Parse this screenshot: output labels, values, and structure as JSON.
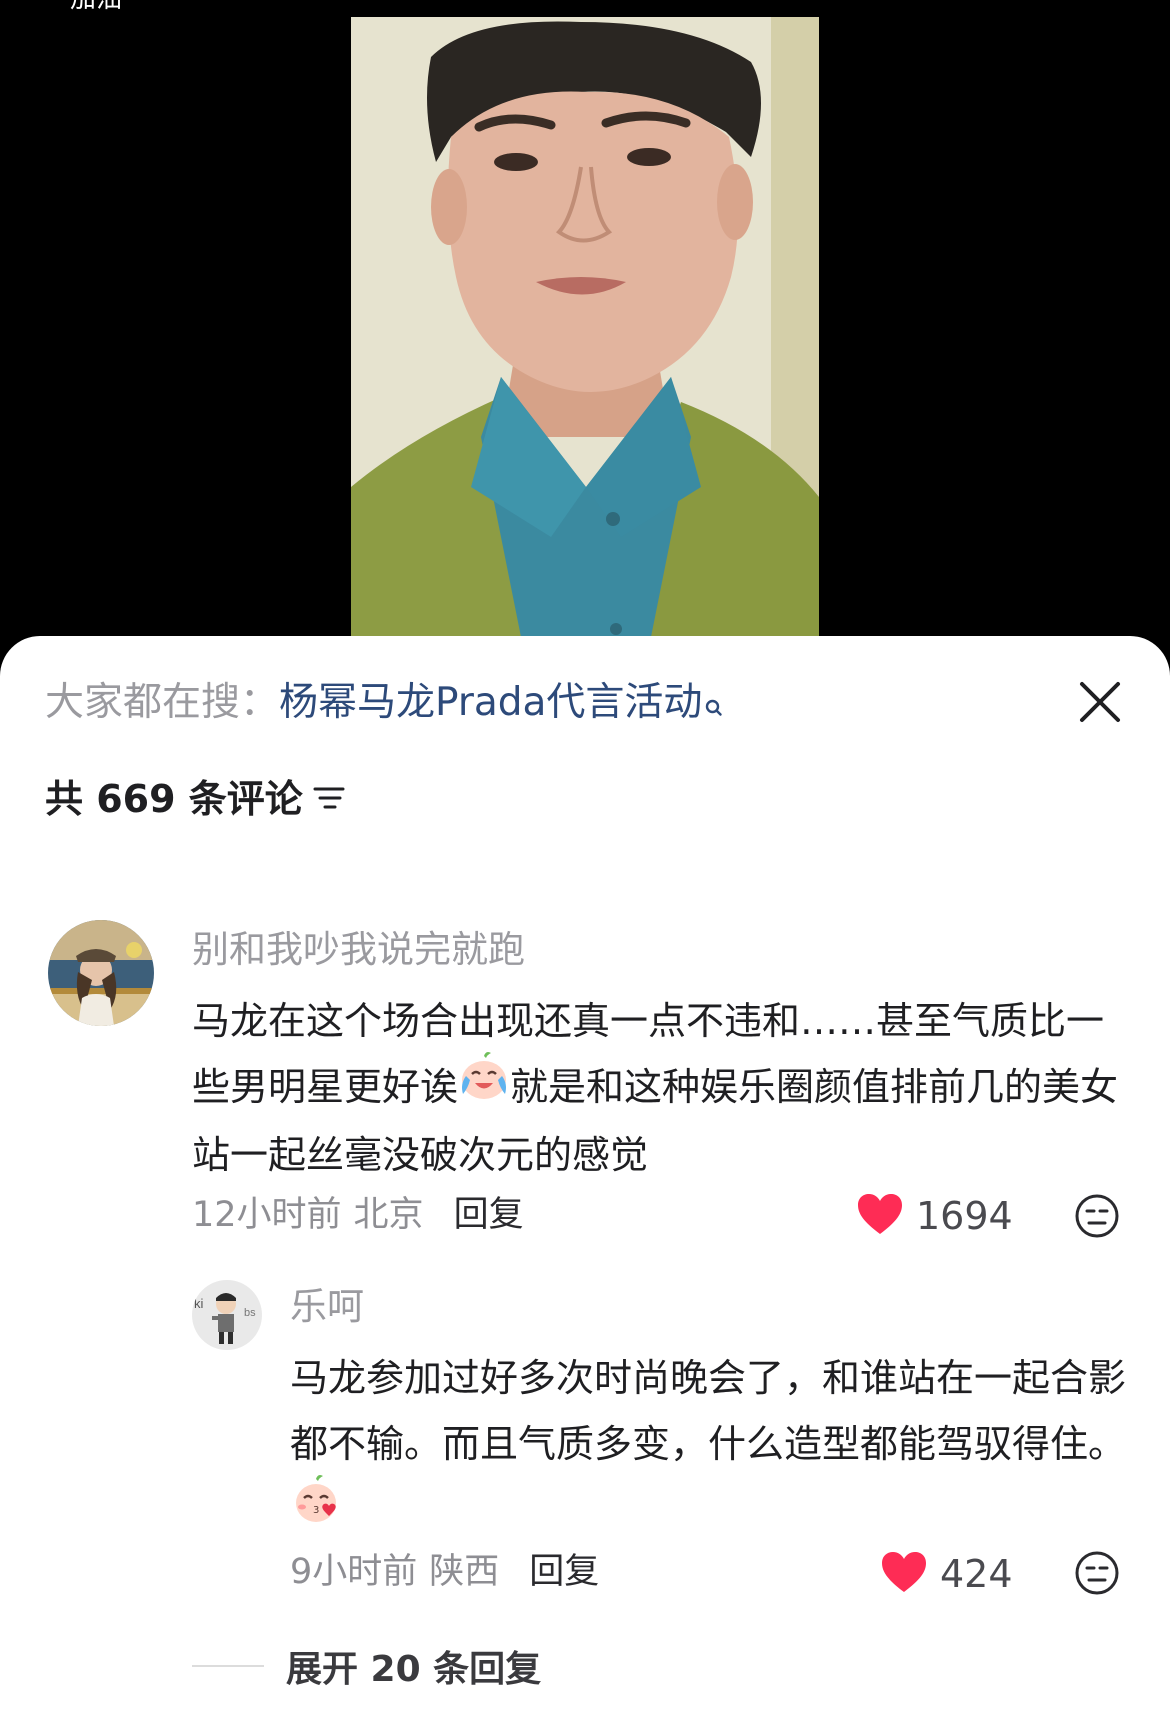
{
  "video": {
    "top_fragment": "加油"
  },
  "search": {
    "prefix": "大家都在搜：",
    "link": "杨幂马龙Prada代言活动"
  },
  "comments_header": {
    "count_label": "共 669 条评论"
  },
  "comments": [
    {
      "username": "别和我吵我说完就跑",
      "text_part1": "马龙在这个场合出现还真一点不违和……甚至气质比一些男明星更好诶",
      "emoji": "laugh-cry-emoji",
      "text_part2": "就是和这种娱乐圈颜值排前几的美女站一起丝毫没破次元的感觉",
      "time": "12小时前",
      "location": "北京",
      "reply_label": "回复",
      "likes": "1694"
    }
  ],
  "replies": [
    {
      "username": "乐呵",
      "text_part1": "马龙参加过好多次时尚晚会了，和谁站在一起合影都不输。而且气质多变，什么造型都能驾驭得住。",
      "emoji": "kiss-heart-emoji",
      "time": "9小时前",
      "location": "陕西",
      "reply_label": "回复",
      "likes": "424"
    }
  ],
  "expand": {
    "label": "展开 20 条回复"
  },
  "colors": {
    "like_red": "#fe2c55",
    "link_blue": "#2d4a7a",
    "muted_gray": "#9a9a9f"
  }
}
